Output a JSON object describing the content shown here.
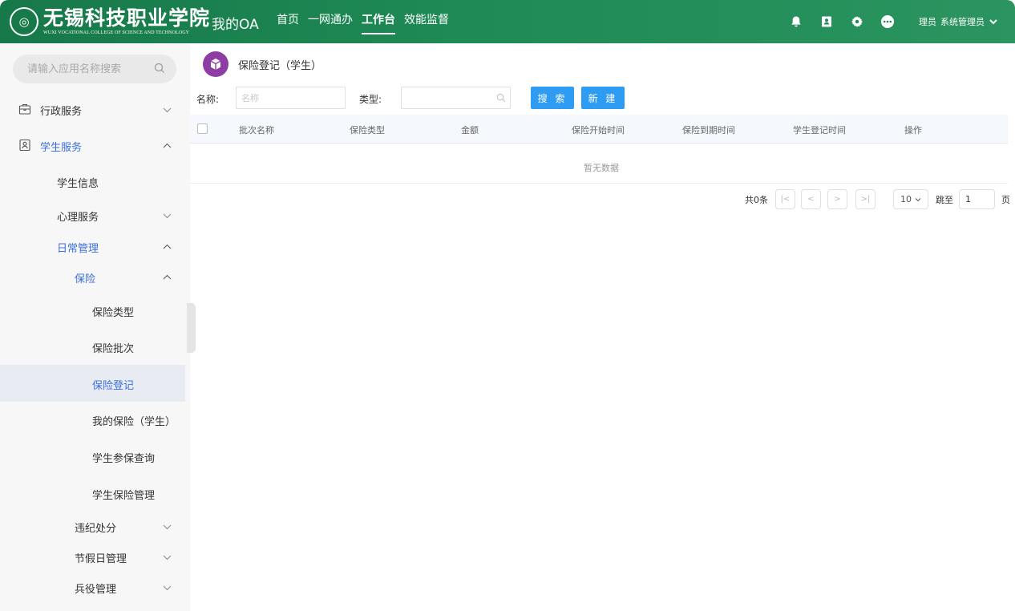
{
  "header": {
    "school_name_cn": "无锡科技职业学院",
    "school_name_en": "WUXI VOCATIONAL COLLEGE OF SCIENCE AND TECHNOLOGY",
    "system_title": "我的OA",
    "nav": [
      "首页",
      "一网通办",
      "工作台",
      "效能监督"
    ],
    "active_nav": "工作台",
    "icons": [
      "bell-icon",
      "contacts-icon",
      "gear-icon",
      "more-icon"
    ],
    "user_role": "理员",
    "user_name": "系统管理员"
  },
  "sidebar": {
    "search_placeholder": "请输入应用名称搜索",
    "items": [
      {
        "label": "行政服务",
        "level": 1,
        "icon": "briefcase-icon",
        "state": "collapsed"
      },
      {
        "label": "学生服务",
        "level": 1,
        "icon": "student-card-icon",
        "state": "expanded",
        "highlight": true
      },
      {
        "label": "学生信息",
        "level": 2
      },
      {
        "label": "心理服务",
        "level": 2,
        "state": "collapsed"
      },
      {
        "label": "日常管理",
        "level": 2,
        "state": "expanded",
        "highlight": true
      },
      {
        "label": "保险",
        "level": 3,
        "state": "expanded",
        "highlight": true
      },
      {
        "label": "保险类型",
        "level": 4
      },
      {
        "label": "保险批次",
        "level": 4
      },
      {
        "label": "保险登记",
        "level": 4,
        "selected": true
      },
      {
        "label": "我的保险（学生）",
        "level": 4
      },
      {
        "label": "学生参保查询",
        "level": 4
      },
      {
        "label": "学生保险管理",
        "level": 4
      },
      {
        "label": "违纪处分",
        "level": 3,
        "state": "collapsed"
      },
      {
        "label": "节假日管理",
        "level": 3,
        "state": "collapsed"
      },
      {
        "label": "兵役管理",
        "level": 3,
        "state": "collapsed"
      }
    ]
  },
  "main": {
    "title": "保险登记（学生）",
    "filters": {
      "name_label": "名称:",
      "name_placeholder": "名称",
      "type_label": "类型:",
      "search_button": "搜 索",
      "new_button": "新 建"
    },
    "table": {
      "columns": [
        "批次名称",
        "保险类型",
        "金额",
        "保险开始时间",
        "保险到期时间",
        "学生登记时间",
        "操作"
      ],
      "rows": [],
      "empty_text": "暂无数据"
    },
    "pagination": {
      "total_text": "共0条",
      "page_size": "10",
      "jump_label": "跳至",
      "jump_value": "1",
      "page_suffix": "页"
    }
  },
  "colors": {
    "header_green": "#1e8a55",
    "accent_blue": "#3b6fe0",
    "button_blue": "#2d9cf2",
    "page_icon_purple": "#8e3da4"
  }
}
